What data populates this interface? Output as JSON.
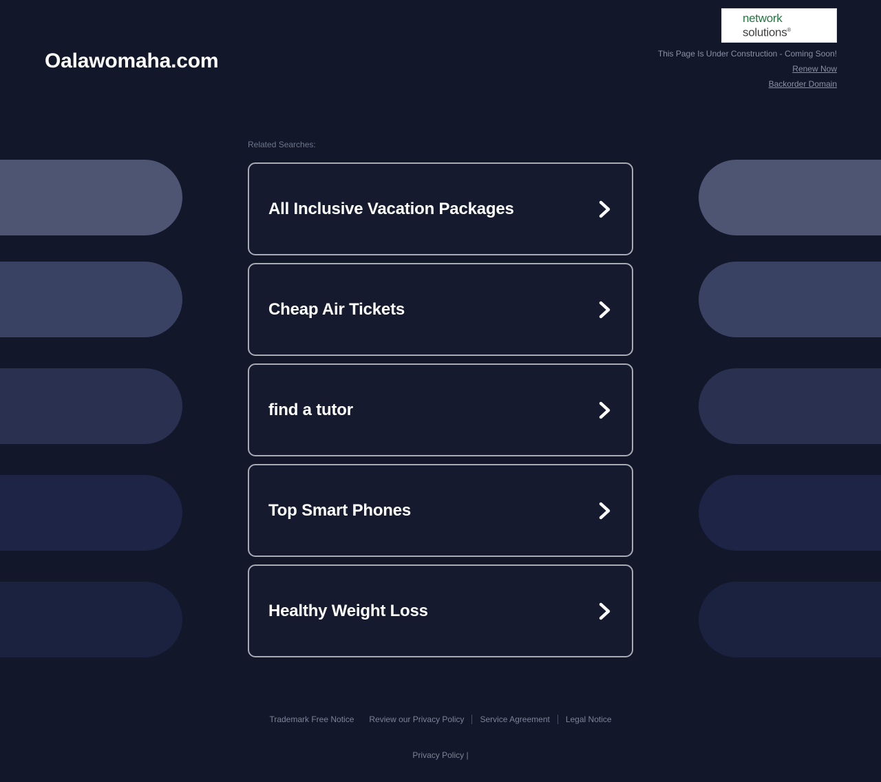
{
  "page": {
    "background_color": "#121729",
    "card_fill": "#151a2e",
    "card_border": "#a8aab4"
  },
  "header": {
    "domain_title": "Oalawomaha.com",
    "logo": {
      "name": "network-solutions-logo",
      "line1": "network",
      "line2": "solutions",
      "registered_mark": "®",
      "line1_color": "#1f7a3d",
      "line2_color": "#3f3f3f"
    },
    "status_text": "This Page Is Under Construction - Coming Soon!",
    "renew_link": "Renew Now",
    "backorder_link": "Backorder Domain"
  },
  "main": {
    "related_label": "Related Searches:",
    "cards": [
      {
        "label": "All Inclusive Vacation Packages",
        "arrow": "chevron-right-icon"
      },
      {
        "label": "Cheap Air Tickets",
        "arrow": "chevron-right-icon"
      },
      {
        "label": "find a tutor",
        "arrow": "chevron-right-icon"
      },
      {
        "label": "Top Smart Phones",
        "arrow": "chevron-right-icon"
      },
      {
        "label": "Healthy Weight Loss",
        "arrow": "chevron-right-icon"
      }
    ]
  },
  "footer": {
    "links": [
      "Trademark Free Notice",
      "Review our Privacy Policy",
      "Service Agreement",
      "Legal Notice"
    ],
    "bottom_text": "Privacy Policy |"
  },
  "decoration": {
    "pill_colors": [
      "#4e5572",
      "#3a4263",
      "#2a3150",
      "#1d2445",
      "#1b2240"
    ]
  }
}
